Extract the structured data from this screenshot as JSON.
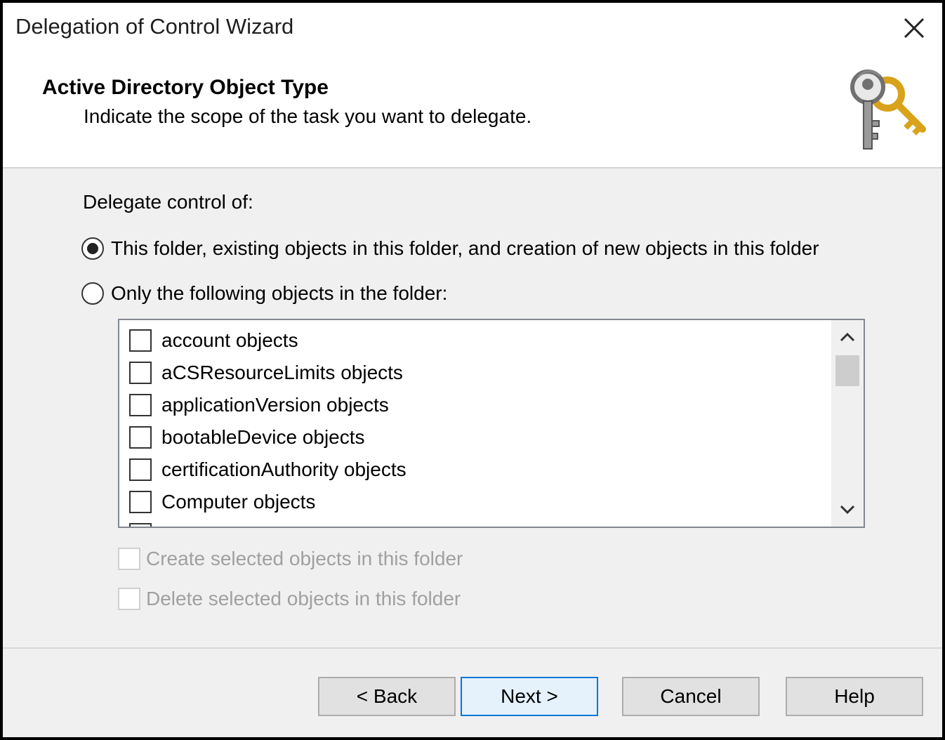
{
  "window": {
    "title": "Delegation of Control Wizard"
  },
  "header": {
    "title": "Active Directory Object Type",
    "subtitle": "Indicate the scope of the task you want to delegate."
  },
  "icons": {
    "close": "close-icon",
    "header": "keys-icon"
  },
  "content": {
    "delegate_label": "Delegate control of:",
    "radio_options": [
      {
        "label": "This folder, existing objects in this folder, and creation of new objects in this folder",
        "selected": true
      },
      {
        "label": "Only the following objects in the folder:",
        "selected": false
      }
    ],
    "object_list": [
      "account objects",
      "aCSResourceLimits objects",
      "applicationVersion objects",
      "bootableDevice objects",
      "certificationAuthority objects",
      "Computer objects"
    ],
    "create_label": "Create selected objects in this folder",
    "delete_label": "Delete selected objects in this folder"
  },
  "buttons": {
    "back": "< Back",
    "next": "Next >",
    "cancel": "Cancel",
    "help": "Help"
  },
  "colors": {
    "default_button_border": "#0078d7",
    "default_button_bg": "#e5f1fb",
    "window_bg": "#f0f0f0"
  }
}
